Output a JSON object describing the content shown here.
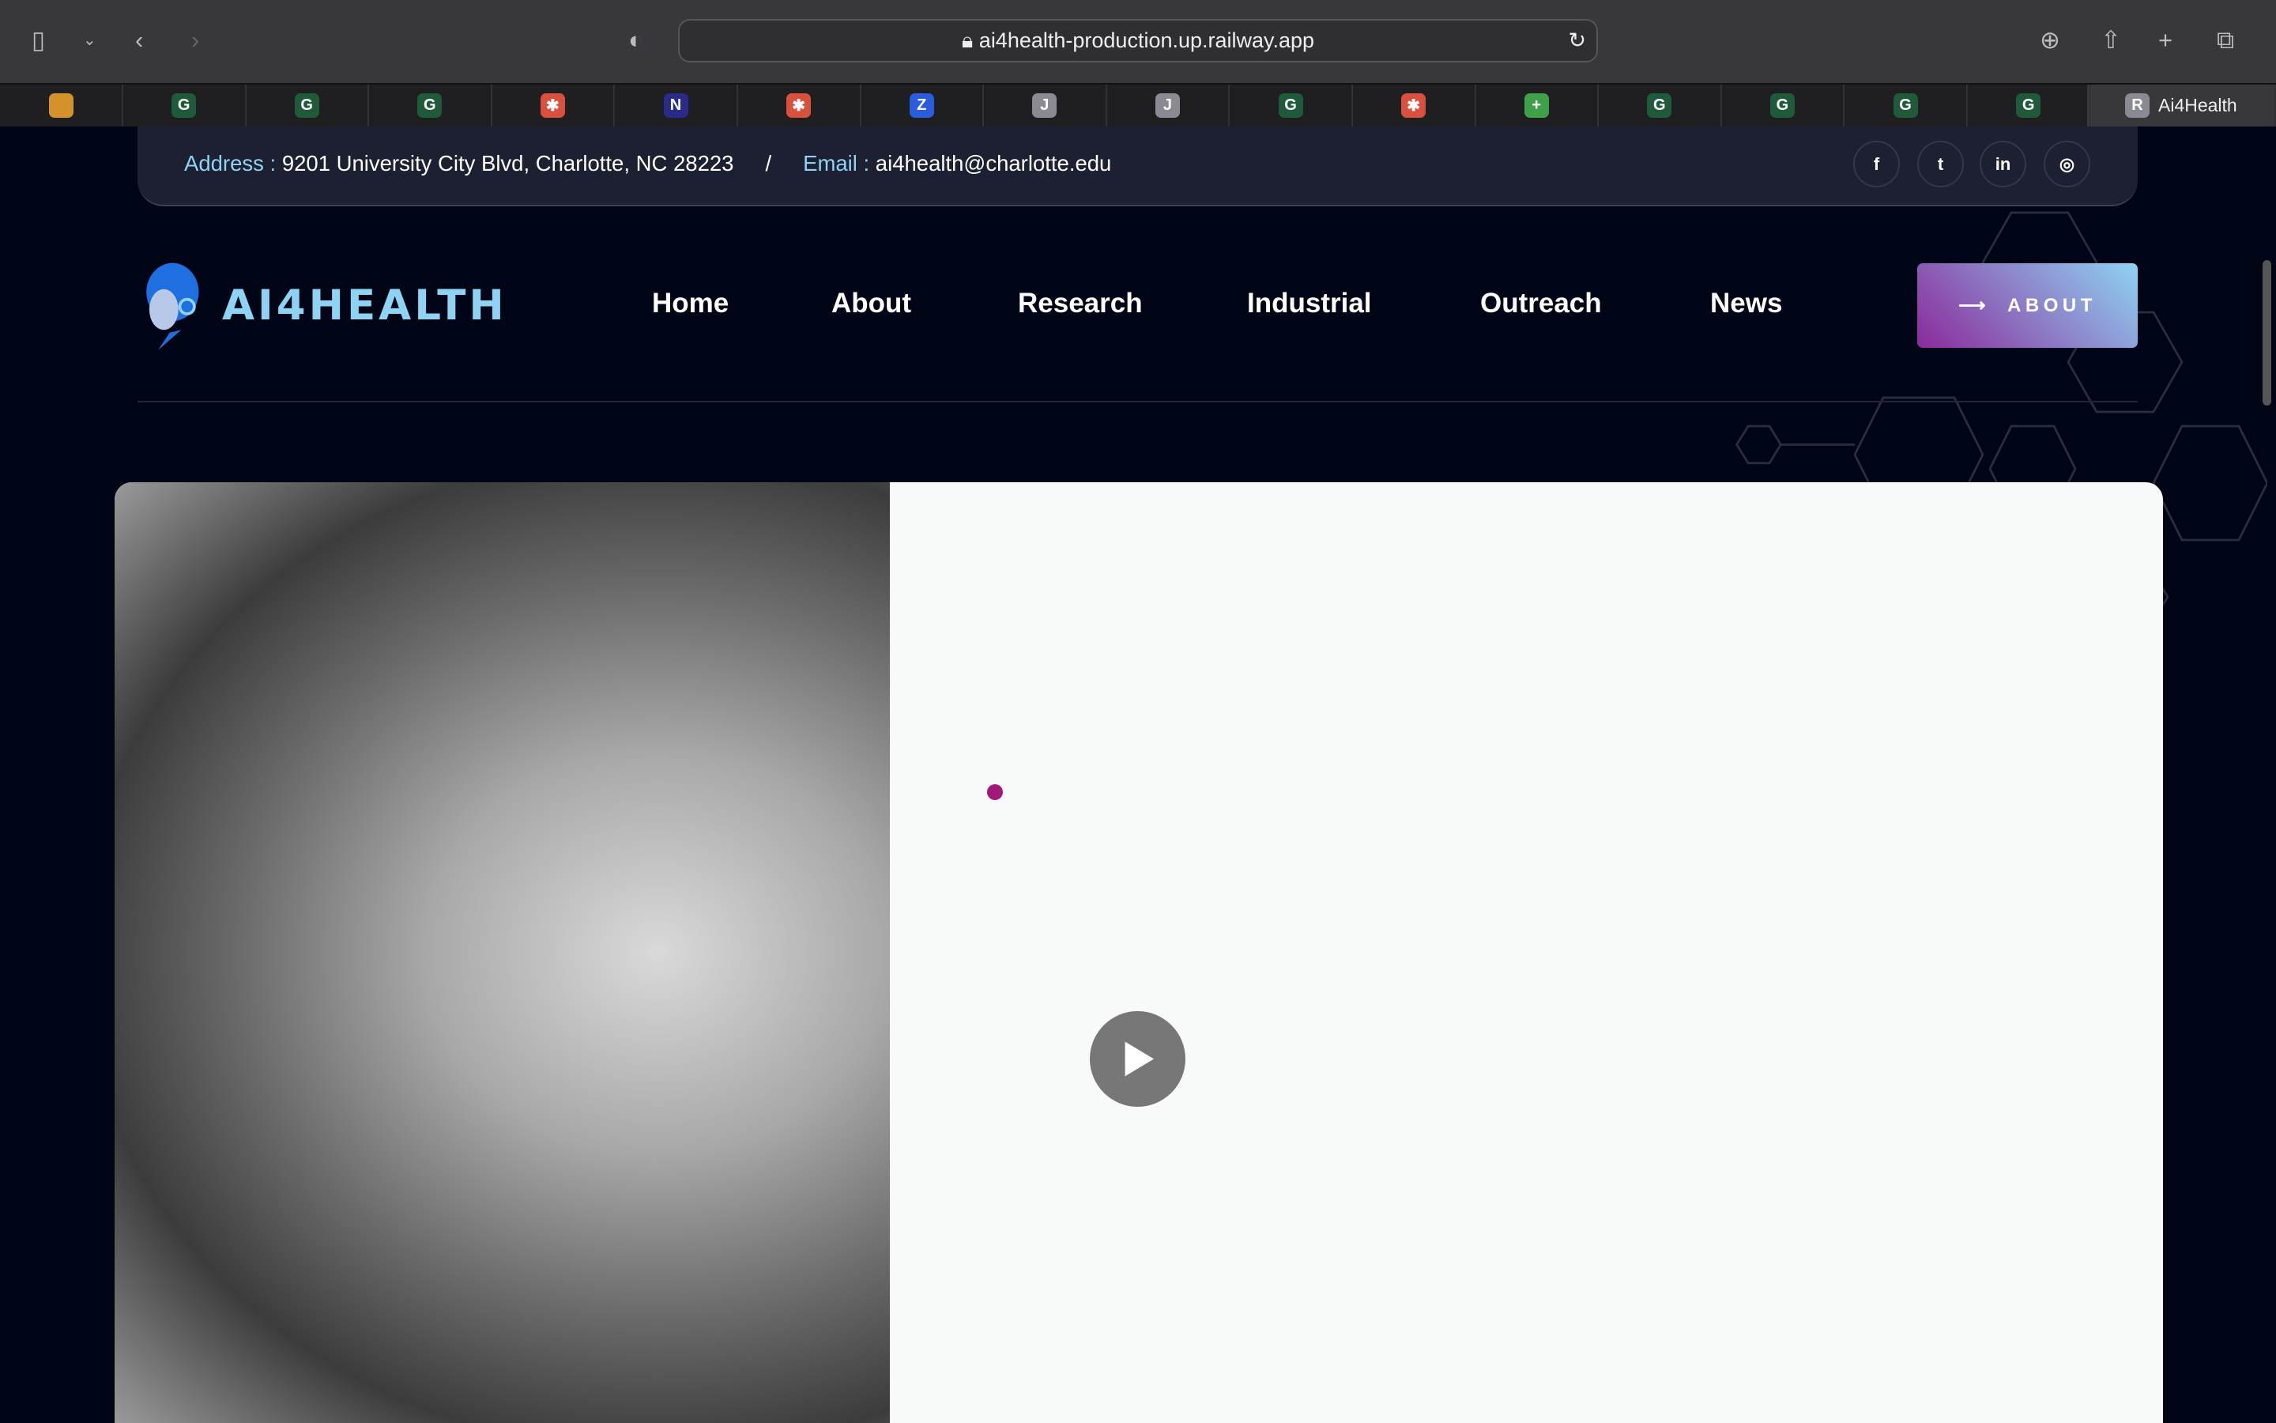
{
  "browser": {
    "url": "ai4health-production.up.railway.app",
    "active_tab": "Ai4Health",
    "active_tab_letter": "R",
    "tabs": [
      {
        "letter": "",
        "color": "#d4922a"
      },
      {
        "letter": "G",
        "color": "#1f5a3a"
      },
      {
        "letter": "G",
        "color": "#1f5a3a"
      },
      {
        "letter": "G",
        "color": "#1f5a3a"
      },
      {
        "letter": "✱",
        "color": "#d9503f"
      },
      {
        "letter": "N",
        "color": "#2a2a8a"
      },
      {
        "letter": "✱",
        "color": "#d9503f"
      },
      {
        "letter": "Z",
        "color": "#2a5ce0"
      },
      {
        "letter": "J",
        "color": "#8a8a92"
      },
      {
        "letter": "J",
        "color": "#8a8a92"
      },
      {
        "letter": "G",
        "color": "#1f5a3a"
      },
      {
        "letter": "✱",
        "color": "#d9503f"
      },
      {
        "letter": "+",
        "color": "#3fa04a"
      },
      {
        "letter": "G",
        "color": "#1f5a3a"
      },
      {
        "letter": "G",
        "color": "#1f5a3a"
      },
      {
        "letter": "G",
        "color": "#1f5a3a"
      },
      {
        "letter": "G",
        "color": "#1f5a3a"
      }
    ]
  },
  "topbar": {
    "address_label": "Address :",
    "address": "9201 University City Blvd, Charlotte, NC 28223",
    "separator": "/",
    "email_label": "Email :",
    "email": "ai4health@charlotte.edu",
    "social": [
      "f",
      "t",
      "in",
      "◎"
    ]
  },
  "header": {
    "logo": "AI4HEALTH",
    "nav": [
      "Home",
      "About",
      "Research",
      "Industrial",
      "Outreach",
      "News"
    ],
    "cta": "ABOUT",
    "cta_arrow": "⟶"
  },
  "colors": {
    "accent": "#8fd3f4",
    "purple": "#8b2a9a",
    "bg": "#000516"
  }
}
